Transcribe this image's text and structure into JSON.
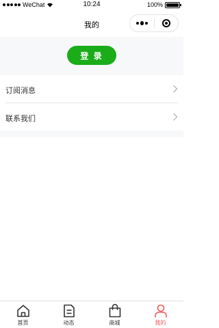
{
  "status_bar": {
    "carrier": "WeChat",
    "time": "10:24",
    "battery": "100%",
    "battery_level": 1.0
  },
  "nav": {
    "title": "我的"
  },
  "login": {
    "label": "登 录",
    "color": "#1aad19"
  },
  "menu": {
    "items": [
      {
        "label": "订阅消息",
        "icon": "chevron-right-icon"
      },
      {
        "label": "联系我们",
        "icon": "chevron-right-icon"
      }
    ]
  },
  "tabbar": {
    "active_color": "#f25757",
    "items": [
      {
        "label": "首页",
        "icon": "home-icon",
        "active": false
      },
      {
        "label": "动态",
        "icon": "document-icon",
        "active": false
      },
      {
        "label": "商城",
        "icon": "shopping-bag-icon",
        "active": false
      },
      {
        "label": "我的",
        "icon": "user-icon",
        "active": true
      }
    ]
  }
}
